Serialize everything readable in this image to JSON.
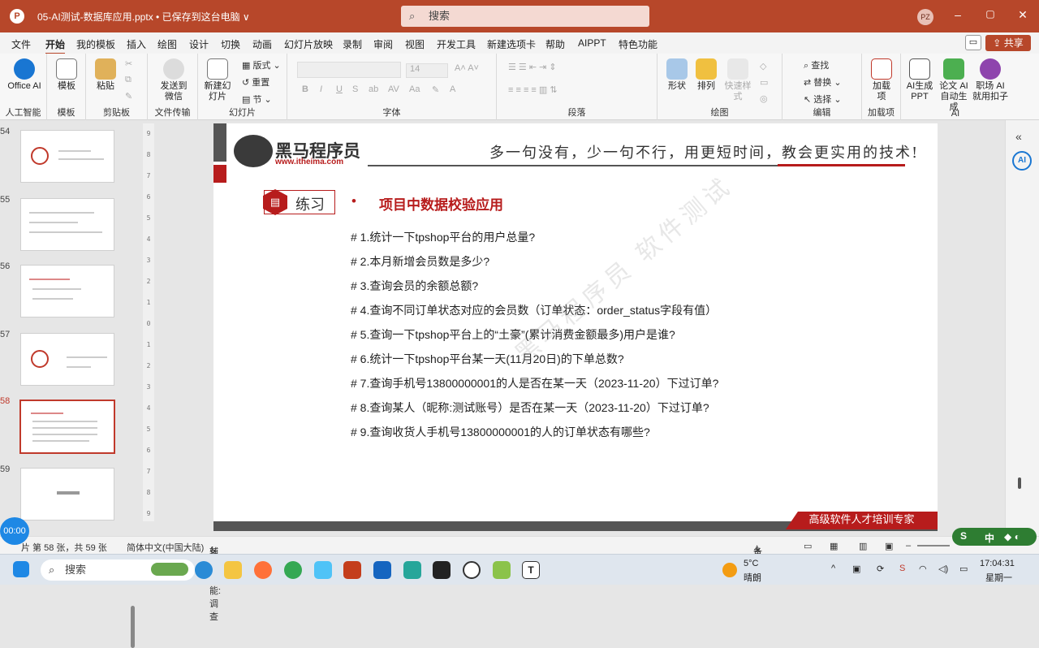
{
  "titlebar": {
    "doc_title": "05-AI测试-数据库应用.pptx • 已保存到这台电脑 ∨",
    "search_placeholder": "搜索",
    "avatar": "PZ",
    "minimize": "–",
    "maximize": "▢",
    "close": "✕"
  },
  "menu": {
    "items": [
      "文件",
      "开始",
      "我的模板",
      "插入",
      "绘图",
      "设计",
      "切换",
      "动画",
      "幻灯片放映",
      "录制",
      "审阅",
      "视图",
      "开发工具",
      "新建选项卡",
      "帮助",
      "AIPPT",
      "特色功能"
    ],
    "share": "共享"
  },
  "ribbon": {
    "groups": [
      "人工智能",
      "模板",
      "剪贴板",
      "文件传输",
      "幻灯片",
      "字体",
      "段落",
      "绘图",
      "编辑",
      "加载项",
      "AI"
    ],
    "office_ai": "Office AI",
    "template": "模板",
    "paste": "粘贴",
    "send_wechat": "发送到微信",
    "new_slide": "新建幻灯片",
    "layout": "版式",
    "reset": "重置",
    "section": "节",
    "font_size": "14",
    "shape": "形状",
    "arrange": "排列",
    "quick_style": "快速样式",
    "find": "查找",
    "replace": "替换",
    "select": "选择",
    "addins": "加载项",
    "ai_ppt": "AI生成PPT",
    "paper_ai": "论文 AI 自动生成",
    "work_ai": "职场 AI 就用扣子"
  },
  "thumbnails": [
    {
      "num": "54"
    },
    {
      "num": "55"
    },
    {
      "num": "56"
    },
    {
      "num": "57"
    },
    {
      "num": "58"
    },
    {
      "num": "59"
    }
  ],
  "ruler": [
    "9",
    "8",
    "7",
    "6",
    "5",
    "4",
    "3",
    "2",
    "1",
    "0",
    "1",
    "2",
    "3",
    "4",
    "5",
    "6",
    "7",
    "8",
    "9"
  ],
  "slide": {
    "brand_cn": "黑马程序员",
    "brand_url": "www.itheima.com",
    "slogan": "多一句没有，少一句不行，用更短时间，教会更实用的技术!",
    "tag": "练习",
    "bullet": "•",
    "section_title": "项目中数据校验应用",
    "questions": [
      "# 1.统计一下tpshop平台的用户总量?",
      "# 2.本月新增会员数是多少?",
      "# 3.查询会员的余额总额?",
      "# 4.查询不同订单状态对应的会员数（订单状态：order_status字段有值）",
      "# 5.查询一下tpshop平台上的“土豪”(累计消费金额最多)用户是谁?",
      "# 6.统计一下tpshop平台某一天(11月20日)的下单总数?",
      "# 7.查询手机号13800000001的人是否在某一天（2023-11-20）下过订单?",
      "# 8.查询某人（昵称:测试账号）是否在某一天（2023-11-20）下过订单?",
      "# 9.查询收货人手机号13800000001的人的订单状态有哪些?"
    ],
    "watermark": "黑马程序员 软件测试",
    "footer_tag": "高级软件人才培训专家"
  },
  "status": {
    "slide_info": "片 第 58 张，共 59 张",
    "language": "简体中文(中国大陆)",
    "accessibility": "辅助功能: 调查",
    "notes": "备注",
    "timer": "00:00",
    "ime_lang": "中"
  },
  "taskbar": {
    "search": "搜索",
    "weather_temp": "5°C",
    "weather_desc": "晴朗",
    "time": "17:04:31",
    "day": "星期一"
  }
}
